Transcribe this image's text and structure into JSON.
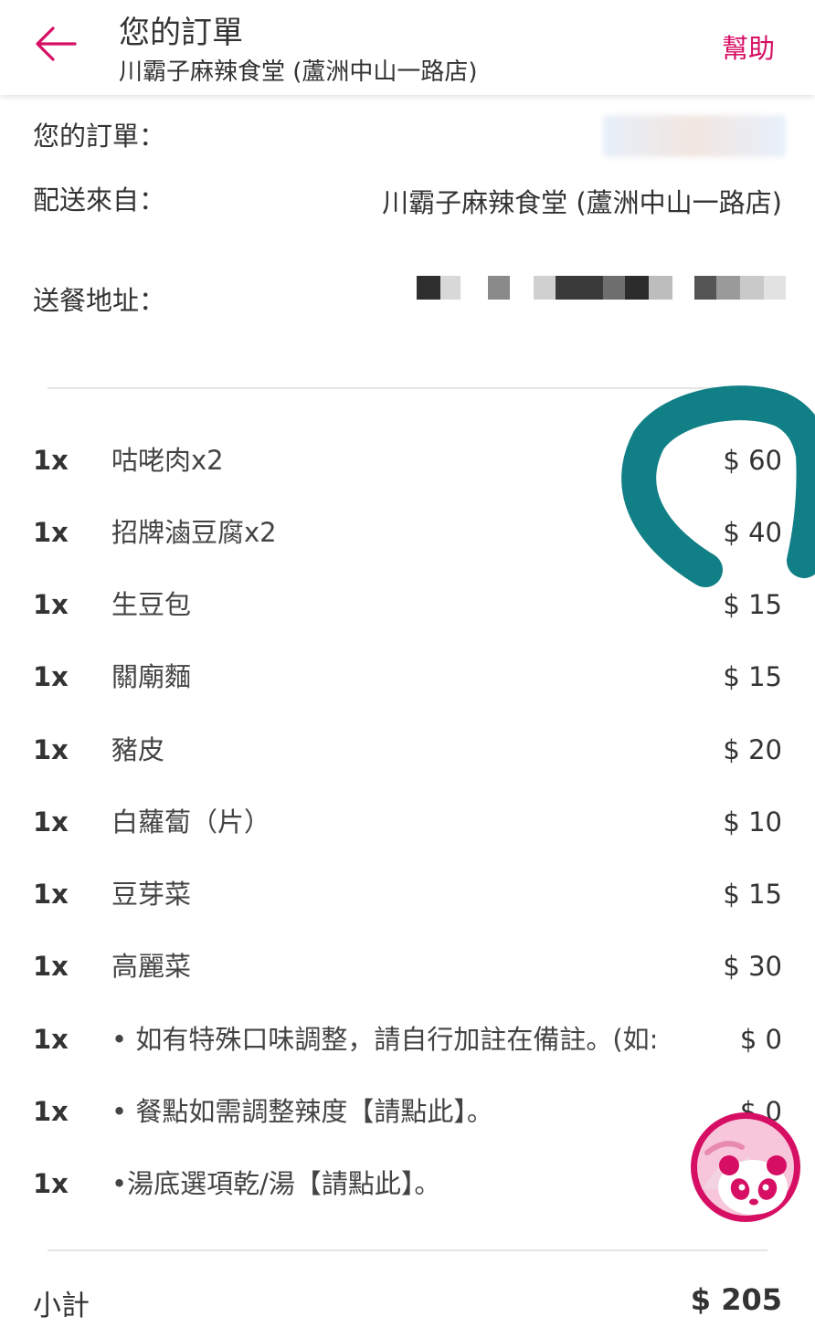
{
  "header": {
    "title": "您的訂單",
    "subtitle": "川霸子麻辣食堂 (蘆洲中山一路店)",
    "help_label": "幫助",
    "accent_color": "#d70f64",
    "back_icon": "arrow-left-icon"
  },
  "order_info": {
    "order_label": "您的訂單：",
    "delivery_from_label": "配送來自：",
    "delivery_from_value": "川霸子麻辣食堂 (蘆洲中山一路店)",
    "address_label": "送餐地址："
  },
  "items": [
    {
      "qty": "1x",
      "name": "咕咾肉x2",
      "price": "$ 60"
    },
    {
      "qty": "1x",
      "name": "招牌滷豆腐x2",
      "price": "$ 40"
    },
    {
      "qty": "1x",
      "name": "生豆包",
      "price": "$ 15"
    },
    {
      "qty": "1x",
      "name": "關廟麵",
      "price": "$ 15"
    },
    {
      "qty": "1x",
      "name": "豬皮",
      "price": "$ 20"
    },
    {
      "qty": "1x",
      "name": "白蘿蔔（片）",
      "price": "$ 10"
    },
    {
      "qty": "1x",
      "name": "豆芽菜",
      "price": "$ 15"
    },
    {
      "qty": "1x",
      "name": "高麗菜",
      "price": "$ 30"
    },
    {
      "qty": "1x",
      "name": "• 如有特殊口味調整，請自行加註在備註。(如:",
      "price": "$ 0"
    },
    {
      "qty": "1x",
      "name": "• 餐點如需調整辣度【請點此】。",
      "price": "$ 0"
    },
    {
      "qty": "1x",
      "name": "•湯底選項乾/湯【請點此】。",
      "price": ""
    }
  ],
  "summary": {
    "subtotal_label": "小計",
    "subtotal_value": "$ 205"
  },
  "overlays": {
    "teal_mark_color": "#117f86",
    "mascot_icon": "foodpanda-panda-icon"
  }
}
